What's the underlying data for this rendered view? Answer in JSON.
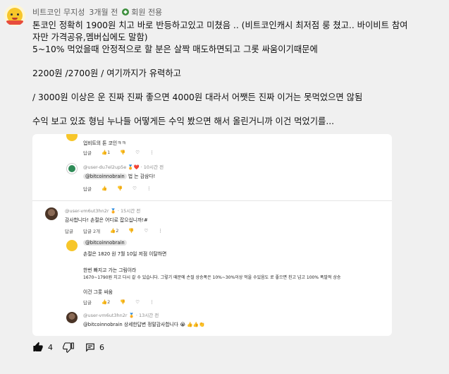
{
  "comment": {
    "author": "비트코인 무지성",
    "time": "3개월 전",
    "member_label": "회원 전용",
    "lines": [
      "톤코인 정확히 1900원 치고 바로 반등하고있고 미쳤음 .. (비트코인캐시 최저점 룽 쳤고.. 바이비트 참여",
      "자만 가격공유,멤버십에도 말함)",
      "5~10% 먹었을때 안정적으로 할 분은 살짝 매도하면되고 그롯 싸움이기때문에",
      "",
      "2200원 /2700원 / 여기까지가 유력하고",
      "",
      "/ 3000원 이상은 운 진짜 진짜 좋으면 4000원 대라서 어쨋든 진짜 이거는 못먹었으면 않됨",
      "",
      "수익 보고 있죠 형님 누나들 어떻게든 수익 봤으면 해서 올린거니까 이건 먹었기를..."
    ],
    "likes": "4",
    "replies": "6"
  },
  "screenshot": {
    "top_reply": {
      "text": "업비트의 톤 코인ㅋㅋ",
      "reply_label": "답글",
      "likes": "1"
    },
    "reply1": {
      "handle": "@user-du7el2up5e",
      "time": "10시간 전",
      "mention": "@bitcoinnobrain",
      "text": "법 는 감삼다!",
      "reply_label": "답글"
    },
    "reply2": {
      "handle": "@user-vm6ut3hn2r",
      "time": "15시간 전",
      "text": "감사합니다! 손절은 어디로 잡으십니까!#",
      "reply_label": "답글",
      "reply_count": "답글 2개",
      "likes": "2"
    },
    "reply3": {
      "mention": "@bitcoinnobrain",
      "line1": "손절은 1820 원 7월 10일 저점 이탈하면",
      "line2": "한번 빠지고 가는 그림이라",
      "line3": "1670~1790원 치고 다시 갈 수 있습니다. 그렇기 때문에 손절 상승폭은 10%~30%이상 먹을 수있음도 로 좋으면 친고 넘고 100% 폭발적 상승",
      "line4": "이건 그롯 싸움",
      "reply_label": "답글",
      "likes": "2"
    },
    "reply4": {
      "handle": "@user-vm6ut3hn2r",
      "time": "13시간 전",
      "mention": "@bitcoinnobrain",
      "text": "상세한답변 정말감사합니다",
      "emoji": "😭 👍👍👏"
    }
  },
  "colors": {
    "background": "#f0f0f0",
    "member_badge": "#3d8f3d"
  }
}
